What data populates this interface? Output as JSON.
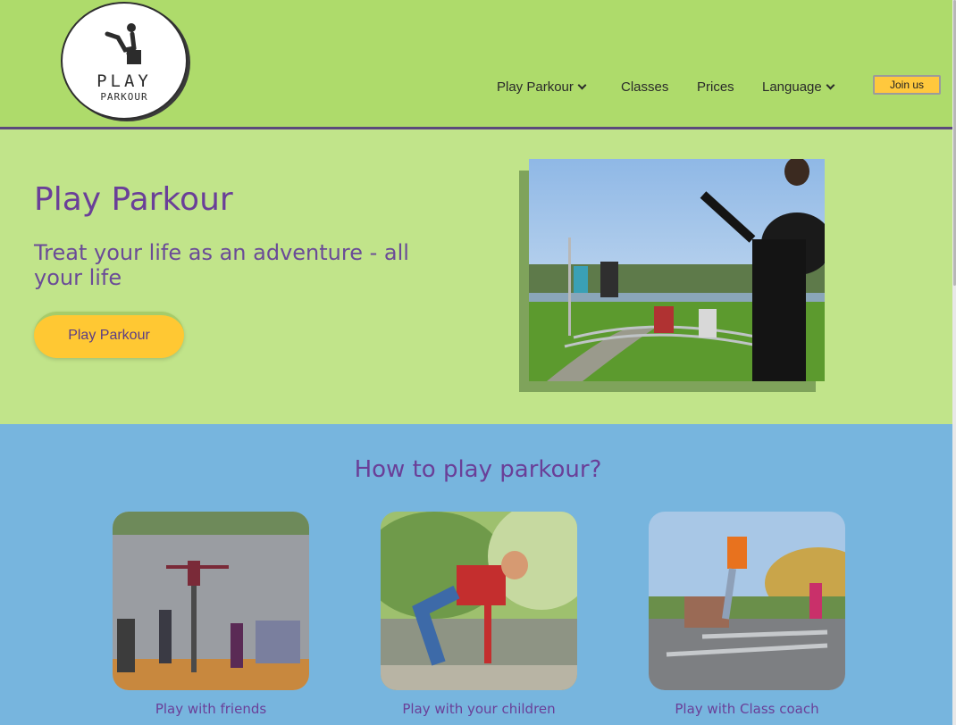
{
  "logo": {
    "line1": "PLAY",
    "line2": "PARKOUR"
  },
  "nav": {
    "items": [
      {
        "label": "Play Parkour",
        "has_dropdown": true
      },
      {
        "label": "Classes",
        "has_dropdown": false
      },
      {
        "label": "Prices",
        "has_dropdown": false
      },
      {
        "label": "Language",
        "has_dropdown": true
      }
    ],
    "join_label": "Join us"
  },
  "hero": {
    "title": "Play Parkour",
    "subtitle": "Treat your life as an adventure - all your life",
    "button_label": "Play Parkour"
  },
  "section": {
    "title": "How to play parkour?",
    "cards": [
      {
        "label": "Play with friends"
      },
      {
        "label": "Play with your children"
      },
      {
        "label": "Play with Class coach"
      }
    ]
  },
  "colors": {
    "header_bg": "#aedb6b",
    "hero_bg": "#c1e48a",
    "section_bg": "#77b5de",
    "accent_purple": "#6a3f98",
    "button_yellow": "#ffc833"
  }
}
